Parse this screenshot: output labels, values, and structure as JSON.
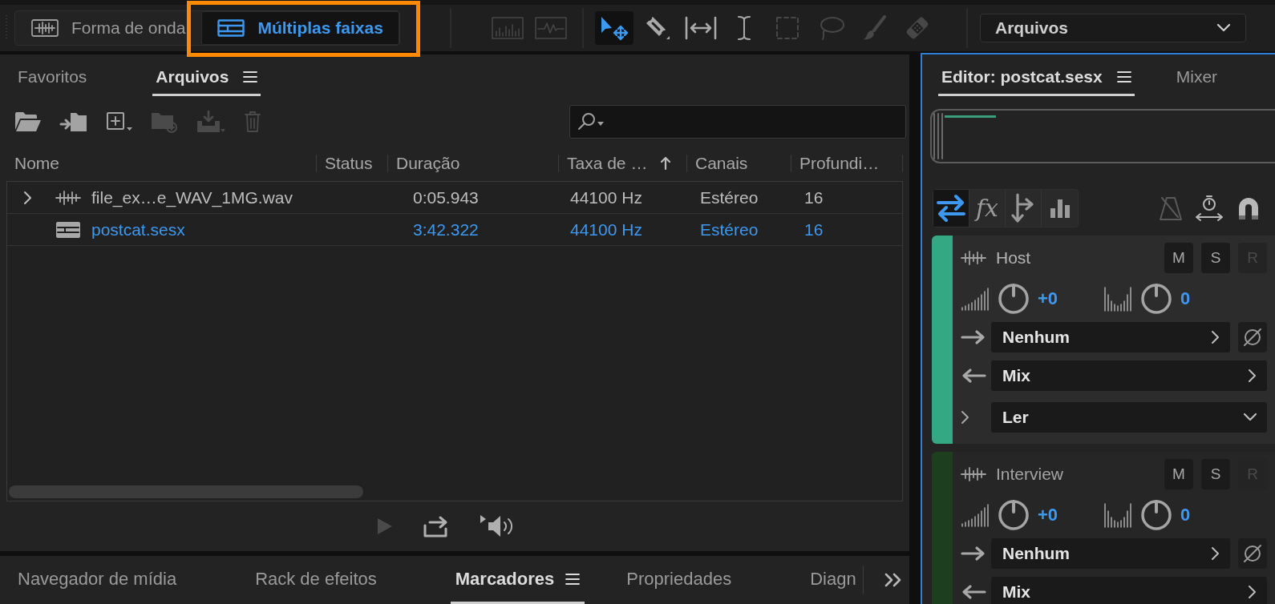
{
  "workspace_tabs": [
    {
      "label": "Forma de onda",
      "kind": "waveform",
      "selected": false,
      "highlighted": false
    },
    {
      "label": "Múltiplas faixas",
      "kind": "multitrack",
      "selected": true,
      "highlighted": true
    }
  ],
  "view_tools": [
    {
      "kind": "spectral",
      "selected": false,
      "disabled": true
    },
    {
      "kind": "waveform",
      "selected": false,
      "disabled": true
    }
  ],
  "edit_tools": [
    {
      "kind": "move",
      "selected": true,
      "disabled": false
    },
    {
      "kind": "razor",
      "selected": false,
      "disabled": false
    },
    {
      "kind": "slip",
      "selected": false,
      "disabled": false
    },
    {
      "kind": "time",
      "selected": false,
      "disabled": false
    },
    {
      "kind": "marquee",
      "selected": false,
      "disabled": true
    },
    {
      "kind": "lasso",
      "selected": false,
      "disabled": true
    },
    {
      "kind": "brush",
      "selected": false,
      "disabled": true
    },
    {
      "kind": "heal",
      "selected": false,
      "disabled": true
    }
  ],
  "workspace": {
    "value": "Arquivos"
  },
  "files_panel": {
    "tabs": [
      {
        "label": "Favoritos",
        "selected": false
      },
      {
        "label": "Arquivos",
        "selected": true
      }
    ],
    "actions": [
      {
        "kind": "open",
        "disabled": false
      },
      {
        "kind": "import",
        "disabled": false
      },
      {
        "kind": "new",
        "disabled": false
      },
      {
        "kind": "new-folder",
        "disabled": true
      },
      {
        "kind": "insert",
        "disabled": true
      },
      {
        "kind": "delete",
        "disabled": true
      }
    ],
    "columns": [
      {
        "label": "Nome",
        "sorted": false
      },
      {
        "label": "Status",
        "sorted": false
      },
      {
        "label": "Duração",
        "sorted": false
      },
      {
        "label": "Taxa de …",
        "sorted": true
      },
      {
        "label": "Canais",
        "sorted": false
      },
      {
        "label": "Profundi…",
        "sorted": false
      }
    ],
    "rows": [
      {
        "kind": "audio",
        "expandable": true,
        "open": false,
        "name": "file_ex…e_WAV_1MG.wav",
        "duration": "0:05.943",
        "sample_rate": "44100 Hz",
        "channels": "Estéreo",
        "depth": "16"
      },
      {
        "kind": "session",
        "expandable": false,
        "open": true,
        "name": "postcat.sesx",
        "duration": "3:42.322",
        "sample_rate": "44100 Hz",
        "channels": "Estéreo",
        "depth": "16"
      }
    ],
    "transport": [
      {
        "kind": "play",
        "disabled": true
      },
      {
        "kind": "loop",
        "disabled": false
      },
      {
        "kind": "autoplay",
        "disabled": false
      }
    ]
  },
  "bottom_tabs": [
    {
      "label": "Navegador de mídia",
      "selected": false
    },
    {
      "label": "Rack de efeitos",
      "selected": false
    },
    {
      "label": "Marcadores",
      "selected": true
    },
    {
      "label": "Propriedades",
      "selected": false
    },
    {
      "label": "Diagn",
      "selected": false
    }
  ],
  "editor_panel": {
    "tabs": [
      {
        "label": "Editor: postcat.sesx",
        "selected": true
      },
      {
        "label": "Mixer",
        "selected": false
      }
    ],
    "views": [
      {
        "kind": "io",
        "selected": true
      },
      {
        "kind": "fx",
        "label": "fx",
        "selected": false
      },
      {
        "kind": "sends",
        "selected": false
      },
      {
        "kind": "eq",
        "selected": false
      }
    ],
    "options": [
      {
        "kind": "metronome",
        "on": false
      },
      {
        "kind": "stretch",
        "on": true
      },
      {
        "kind": "snap",
        "on": true
      }
    ],
    "tracks": [
      {
        "name": "Host",
        "color": "#34a883",
        "selected": true,
        "buttons": [
          {
            "label": "M",
            "on": false,
            "disabled": false
          },
          {
            "label": "S",
            "on": false,
            "disabled": false
          },
          {
            "label": "R",
            "on": false,
            "disabled": true
          }
        ],
        "volume": "+0",
        "pan": "0",
        "input": "Nenhum",
        "output": "Mix",
        "automation": "Ler"
      },
      {
        "name": "Interview",
        "color": "#1d3f20",
        "selected": false,
        "buttons": [
          {
            "label": "M",
            "on": false,
            "disabled": false
          },
          {
            "label": "S",
            "on": false,
            "disabled": false
          },
          {
            "label": "R",
            "on": false,
            "disabled": true
          }
        ],
        "volume": "+0",
        "pan": "0",
        "input": "Nenhum",
        "output": "Mix"
      }
    ]
  }
}
